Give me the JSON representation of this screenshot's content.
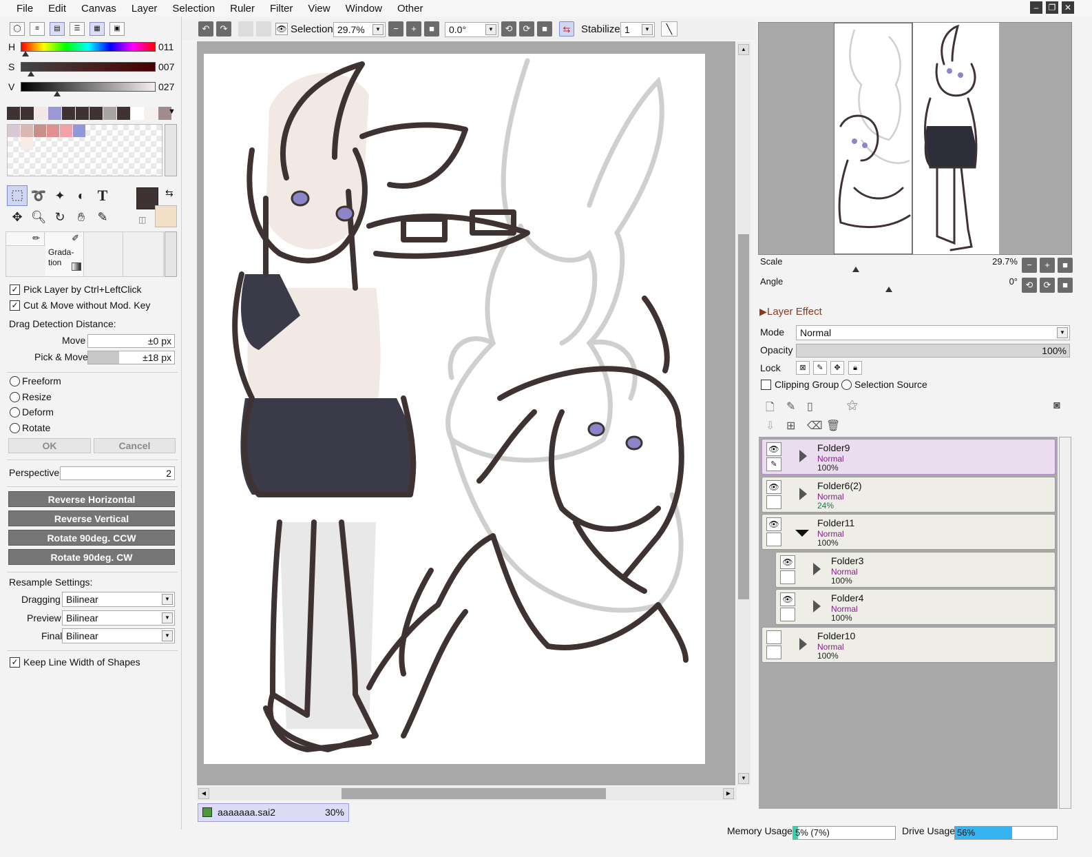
{
  "menu": [
    "File",
    "Edit",
    "Canvas",
    "Layer",
    "Selection",
    "Ruler",
    "Filter",
    "View",
    "Window",
    "Other"
  ],
  "window_controls": {
    "minimize": "–",
    "restore": "❐",
    "close": "✕"
  },
  "color": {
    "h_label": "H",
    "h_value": "011",
    "s_label": "S",
    "s_value": "007",
    "v_label": "V",
    "v_value": "027",
    "foreground": "#3f3232",
    "background": "#f2dfc8"
  },
  "swatches": [
    "#3f3232",
    "#3f3232",
    "#f2e9e7",
    "#9c98d6",
    "#3f3232",
    "#3f3232",
    "#3f3232",
    "#aaa4a4",
    "#3f3232",
    "#ffffff",
    "#f5f0ee",
    "#a08c8c"
  ],
  "palette": [
    "#d8c8d4",
    "#d8b8b0",
    "#c89088",
    "#e09090",
    "#f4a0a8",
    "#9098d8",
    "#f8ece8"
  ],
  "brush_panel": {
    "gradation_label": "Grada-\ntion"
  },
  "options": {
    "pick_layer": "Pick Layer by Ctrl+LeftClick",
    "cut_move": "Cut & Move without Mod. Key",
    "drag_detection": "Drag Detection Distance:",
    "move_label": "Move",
    "move_value": "±0 px",
    "pick_move_label": "Pick & Move",
    "pick_move_value": "±18 px",
    "freeform": "Freeform",
    "resize": "Resize",
    "deform": "Deform",
    "rotate": "Rotate",
    "ok": "OK",
    "cancel": "Cancel",
    "perspective_label": "Perspective",
    "perspective_value": "2",
    "reverse_h": "Reverse Horizontal",
    "reverse_v": "Reverse Vertical",
    "rot_ccw": "Rotate 90deg. CCW",
    "rot_cw": "Rotate 90deg. CW",
    "resample": "Resample Settings:",
    "dragging_label": "Dragging",
    "dragging_value": "Bilinear",
    "preview_label": "Preview",
    "preview_value": "Bilinear",
    "final_label": "Final",
    "final_value": "Bilinear",
    "keep_line": "Keep Line Width of Shapes"
  },
  "toolbar": {
    "selection_label": "Selection",
    "zoom": "29.7%",
    "angle": "0.0°",
    "stabilizer_label": "Stabilizer",
    "stabilizer_value": "1"
  },
  "document_tab": {
    "name": "aaaaaaa.sai2",
    "zoom": "30%"
  },
  "navigator": {
    "scale_label": "Scale",
    "scale_value": "29.7%",
    "angle_label": "Angle",
    "angle_value": "0°"
  },
  "layer_panel": {
    "effect_label": "Layer Effect",
    "mode_label": "Mode",
    "mode_value": "Normal",
    "opacity_label": "Opacity",
    "opacity_value": "100%",
    "lock_label": "Lock",
    "clipping_label": "Clipping Group",
    "selection_source_label": "Selection Source"
  },
  "layers": [
    {
      "name": "Folder9",
      "mode": "Normal",
      "opacity": "100%",
      "selected": true,
      "visible": true,
      "expanded": false,
      "indent": 0
    },
    {
      "name": "Folder6(2)",
      "mode": "Normal",
      "opacity": "24%",
      "selected": false,
      "visible": true,
      "expanded": false,
      "indent": 0
    },
    {
      "name": "Folder11",
      "mode": "Normal",
      "opacity": "100%",
      "selected": false,
      "visible": true,
      "expanded": true,
      "indent": 0
    },
    {
      "name": "Folder3",
      "mode": "Normal",
      "opacity": "100%",
      "selected": false,
      "visible": true,
      "expanded": false,
      "indent": 1
    },
    {
      "name": "Folder4",
      "mode": "Normal",
      "opacity": "100%",
      "selected": false,
      "visible": true,
      "expanded": false,
      "indent": 1
    },
    {
      "name": "Folder10",
      "mode": "Normal",
      "opacity": "100%",
      "selected": false,
      "visible": false,
      "expanded": false,
      "indent": 0
    }
  ],
  "status": {
    "memory_label": "Memory Usage",
    "memory_value": "5% (7%)",
    "memory_fraction": 0.05,
    "drive_label": "Drive Usage",
    "drive_value": "56%",
    "drive_fraction": 0.56
  }
}
